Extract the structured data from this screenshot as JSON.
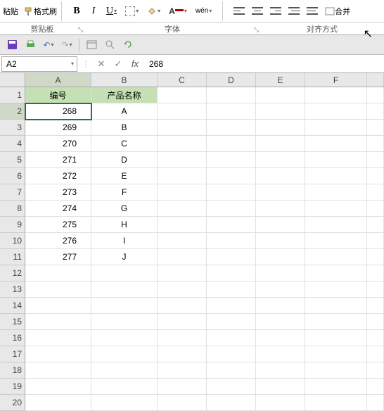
{
  "ribbon": {
    "paste": "粘贴",
    "format_painter": "格式刷",
    "bold": "B",
    "italic": "I",
    "underline": "U",
    "wen": "wén",
    "merge": "合并"
  },
  "sections": {
    "clipboard": "剪贴板",
    "font": "字体",
    "alignment": "对齐方式"
  },
  "name_box": "A2",
  "fx": "fx",
  "formula_value": "268",
  "columns": [
    "A",
    "B",
    "C",
    "D",
    "E",
    "F"
  ],
  "headers": {
    "A": "编号",
    "B": "产品名称"
  },
  "rows": [
    {
      "n": 1,
      "A": "编号",
      "B": "产品名称",
      "hdr": true
    },
    {
      "n": 2,
      "A": "268",
      "B": "A"
    },
    {
      "n": 3,
      "A": "269",
      "B": "B"
    },
    {
      "n": 4,
      "A": "270",
      "B": "C"
    },
    {
      "n": 5,
      "A": "271",
      "B": "D"
    },
    {
      "n": 6,
      "A": "272",
      "B": "E"
    },
    {
      "n": 7,
      "A": "273",
      "B": "F"
    },
    {
      "n": 8,
      "A": "274",
      "B": "G"
    },
    {
      "n": 9,
      "A": "275",
      "B": "H"
    },
    {
      "n": 10,
      "A": "276",
      "B": "I"
    },
    {
      "n": 11,
      "A": "277",
      "B": "J"
    },
    {
      "n": 12,
      "A": "",
      "B": ""
    },
    {
      "n": 13,
      "A": "",
      "B": ""
    },
    {
      "n": 14,
      "A": "",
      "B": ""
    },
    {
      "n": 15,
      "A": "",
      "B": ""
    },
    {
      "n": 16,
      "A": "",
      "B": ""
    },
    {
      "n": 17,
      "A": "",
      "B": ""
    },
    {
      "n": 18,
      "A": "",
      "B": ""
    },
    {
      "n": 19,
      "A": "",
      "B": ""
    },
    {
      "n": 20,
      "A": "",
      "B": ""
    }
  ],
  "active_cell": "A2"
}
